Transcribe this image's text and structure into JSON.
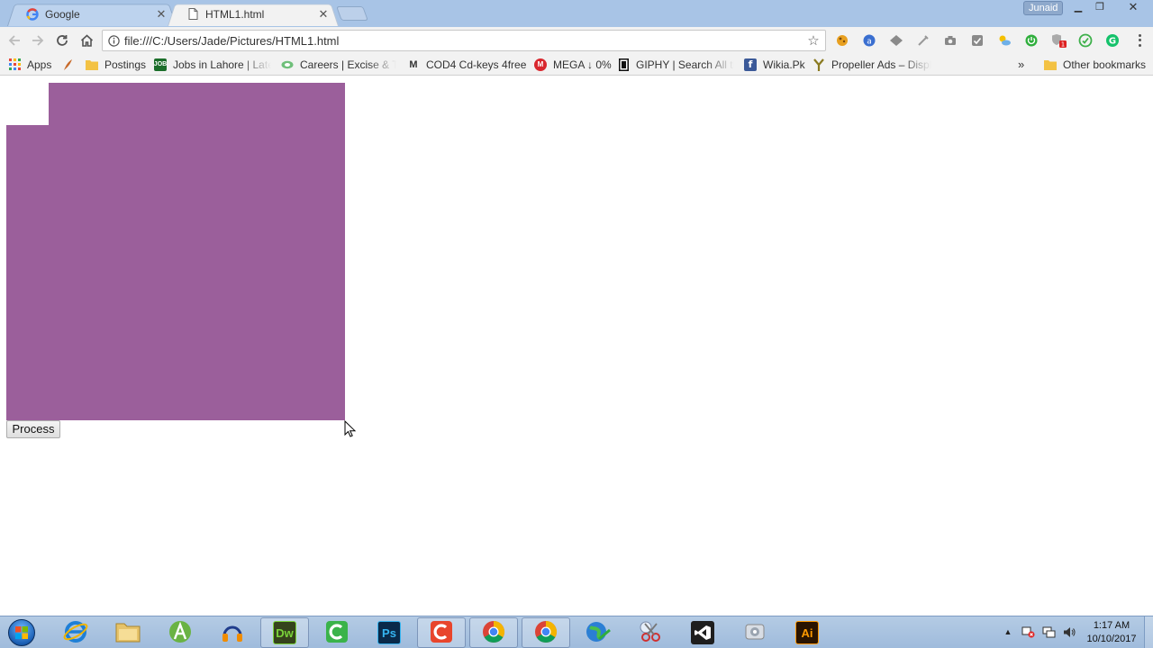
{
  "browser": {
    "tabs": [
      {
        "title": "Google",
        "favicon": "google-icon",
        "active": false
      },
      {
        "title": "HTML1.html",
        "favicon": "page-icon",
        "active": true
      }
    ],
    "profile_name": "Junaid",
    "url": "file:///C:/Users/Jade/Pictures/HTML1.html",
    "bookmarks": [
      {
        "label": "Apps",
        "icon": "apps-grid-icon"
      },
      {
        "label": "",
        "icon": "feather-icon"
      },
      {
        "label": "Postings",
        "icon": "folder-icon"
      },
      {
        "label": "Jobs in Lahore | Lates",
        "icon": "jobz-icon"
      },
      {
        "label": "Careers | Excise & Ta",
        "icon": "careers-icon"
      },
      {
        "label": "COD4 Cd-keys 4free",
        "icon": "m-icon"
      },
      {
        "label": "MEGA ↓ 0%",
        "icon": "mega-icon"
      },
      {
        "label": "GIPHY | Search All th",
        "icon": "giphy-icon"
      },
      {
        "label": "Wikia.Pk",
        "icon": "facebook-icon"
      },
      {
        "label": "Propeller Ads – Displ",
        "icon": "propeller-icon"
      }
    ],
    "other_bookmarks": "Other bookmarks",
    "overflow": "»"
  },
  "page": {
    "button_label": "Process",
    "box_color": "#9b5f9b"
  },
  "taskbar": {
    "apps": [
      "internet-explorer",
      "file-explorer",
      "android-studio",
      "audacity",
      "dreamweaver",
      "camtasia",
      "photoshop",
      "unknown-orange",
      "chrome",
      "chrome",
      "globe",
      "snipping-tool",
      "visual-studio",
      "system-tool",
      "illustrator"
    ],
    "labels": {
      "dw": "Dw",
      "ps": "Ps",
      "ai": "Ai"
    },
    "time": "1:17 AM",
    "date": "10/10/2017"
  }
}
